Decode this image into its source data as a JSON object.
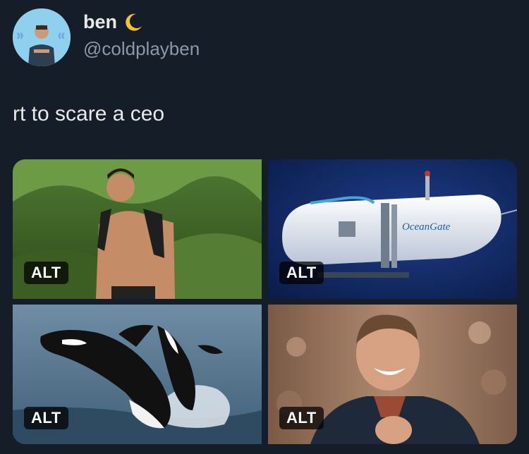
{
  "post": {
    "display_name": "ben",
    "handle": "@coldplayben",
    "text": "rt to scare a ceo"
  },
  "media": [
    {
      "alt_label": "ALT",
      "subject": "shirtless man hiking"
    },
    {
      "alt_label": "ALT",
      "subject": "submarine",
      "logo_text": "OceanGate"
    },
    {
      "alt_label": "ALT",
      "subject": "orcas breaching"
    },
    {
      "alt_label": "ALT",
      "subject": "smiling man"
    }
  ],
  "colors": {
    "background": "#151d28",
    "handle": "#8b98a5",
    "text": "#e7e9ea"
  },
  "icons": {
    "name_emoji": "crescent-moon-icon"
  }
}
